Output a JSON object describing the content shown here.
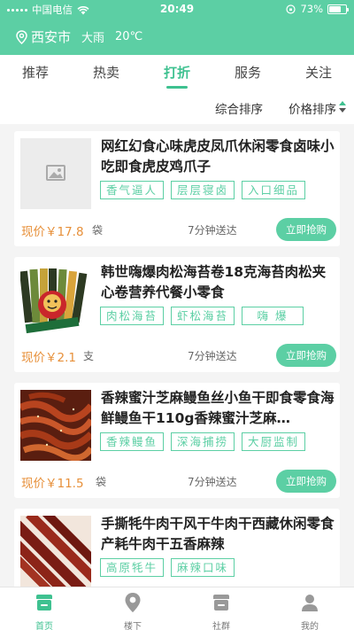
{
  "status_bar": {
    "carrier": "中国电信",
    "time": "20:49",
    "battery": "73%",
    "battery_level": 0.73
  },
  "location": {
    "city": "西安市",
    "weather": "大雨",
    "temp": "20℃"
  },
  "tabs": [
    {
      "label": "推荐"
    },
    {
      "label": "热卖"
    },
    {
      "label": "打折"
    },
    {
      "label": "服务"
    },
    {
      "label": "关注"
    }
  ],
  "active_tab": "打折",
  "sort": {
    "composite": "综合排序",
    "price": "价格排序"
  },
  "products": [
    {
      "title": "网红幻食心味虎皮凤爪休闲零食卤味小吃即食虎皮鸡爪子",
      "tags": [
        "香气逼人",
        "层层寝卤",
        "入口细品"
      ],
      "price": "现价￥17.8",
      "unit": "袋",
      "delivery": "7分钟送达",
      "buy_label": "立即抢购",
      "image": "placeholder-image-icon"
    },
    {
      "title": "韩世嗨爆肉松海苔卷18克海苔肉松夹心卷营养代餐小零食",
      "tags": [
        "肉松海苔",
        "虾松海苔",
        "嗨 爆"
      ],
      "price": "现价￥2.1",
      "unit": "支",
      "delivery": "7分钟送达",
      "buy_label": "立即抢购",
      "image": "seaweed-roll-photo"
    },
    {
      "title": "香辣蜜汁芝麻鳗鱼丝小鱼干即食零食海鲜鳗鱼干110g香辣蜜汁芝麻…",
      "tags": [
        "香辣鳗鱼",
        "深海捕捞",
        "大厨监制"
      ],
      "price": "现价￥11.5",
      "unit": "袋",
      "delivery": "7分钟送达",
      "buy_label": "立即抢购",
      "image": "eel-strips-photo"
    },
    {
      "title": "手撕牦牛肉干风干牛肉干西藏休闲零食产耗牛肉干五香麻辣",
      "tags": [
        "高原牦牛",
        "麻辣口味"
      ],
      "price": "",
      "unit": "",
      "delivery": "",
      "buy_label": "",
      "image": "beef-jerky-photo"
    }
  ],
  "bottom_nav": [
    {
      "label": "首页",
      "icon": "home-icon"
    },
    {
      "label": "楼下",
      "icon": "location-pin-icon"
    },
    {
      "label": "社群",
      "icon": "community-icon"
    },
    {
      "label": "我的",
      "icon": "user-icon"
    }
  ],
  "colors": {
    "accent": "#5ccfa4",
    "accent_dark": "#3ec190",
    "price": "#e7903a"
  }
}
